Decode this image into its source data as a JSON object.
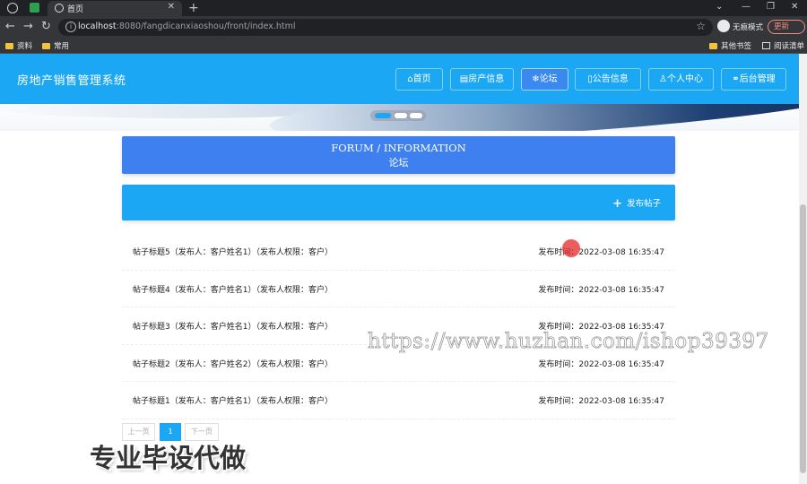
{
  "browser": {
    "tab_title": "首页",
    "url_host": "localhost",
    "url_rest": ":8080/fangdicanxiaoshou/front/index.html",
    "incognito_label": "无痕模式",
    "update_label": "更新",
    "bookmarks": [
      {
        "label": "资料",
        "icon": "folder-icon"
      },
      {
        "label": "常用",
        "icon": "folder-icon"
      }
    ],
    "bookmarks_right": [
      {
        "label": "其他书签",
        "icon": "folder-icon"
      },
      {
        "label": "阅读清单",
        "icon": "reading-list-icon"
      }
    ]
  },
  "header": {
    "site_title": "房地产销售管理系统",
    "nav": [
      {
        "label": "首页",
        "icon": "home-icon",
        "glyph": "⌂"
      },
      {
        "label": "房产信息",
        "icon": "building-icon",
        "glyph": "▤"
      },
      {
        "label": "论坛",
        "icon": "snowflake-icon",
        "glyph": "❄",
        "active": true
      },
      {
        "label": "公告信息",
        "icon": "notice-icon",
        "glyph": "▯"
      },
      {
        "label": "个人中心",
        "icon": "user-icon",
        "glyph": "♙"
      },
      {
        "label": "后台管理",
        "icon": "link-icon",
        "glyph": "⚭"
      }
    ]
  },
  "forum": {
    "title_en": "FORUM / INFORMATION",
    "title_cn": "论坛",
    "post_button": "发布帖子",
    "posts": [
      {
        "title": "帖子标题5（发布人：客户姓名1）（发布人权限：客户）",
        "time": "发布时间：2022-03-08 16:35:47"
      },
      {
        "title": "帖子标题4（发布人：客户姓名1）（发布人权限：客户）",
        "time": "发布时间：2022-03-08 16:35:47"
      },
      {
        "title": "帖子标题3（发布人：客户姓名1）（发布人权限：客户）",
        "time": "发布时间：2022-03-08 16:35:47"
      },
      {
        "title": "帖子标题2（发布人：客户姓名2）（发布人权限：客户）",
        "time": "发布时间：2022-03-08 16:35:47"
      },
      {
        "title": "帖子标题1（发布人：客户姓名1）（发布人权限：客户）",
        "time": "发布时间：2022-03-08 16:35:47"
      }
    ],
    "pager": {
      "prev": "上一页",
      "current": "1",
      "next": "下一页"
    }
  },
  "overlay": {
    "watermark_url": "https://www.huzhan.com/ishop39397",
    "watermark_cn": "专业毕设代做"
  },
  "colors": {
    "primary": "#1ca7f5",
    "active_nav": "#3a89f0",
    "forum_head": "#3f80f0"
  }
}
